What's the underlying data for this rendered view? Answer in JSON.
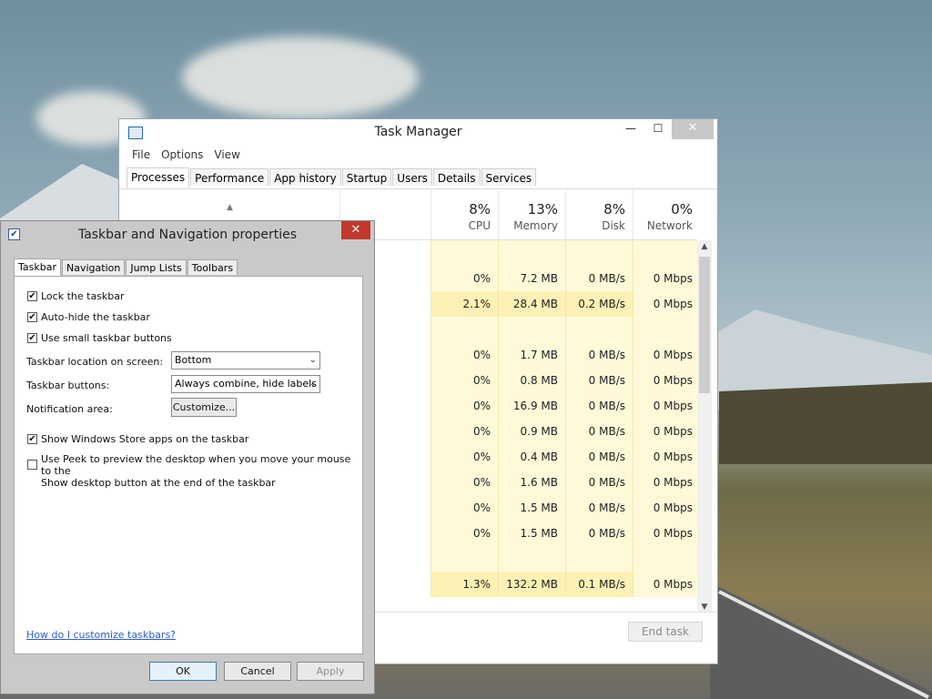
{
  "task_manager": {
    "title": "Task Manager",
    "menu": [
      "File",
      "Options",
      "View"
    ],
    "tabs": [
      "Processes",
      "Performance",
      "App history",
      "Startup",
      "Users",
      "Details",
      "Services"
    ],
    "active_tab": "Processes",
    "columns": [
      {
        "pct": "8%",
        "label": "CPU"
      },
      {
        "pct": "13%",
        "label": "Memory"
      },
      {
        "pct": "8%",
        "label": "Disk"
      },
      {
        "pct": "0%",
        "label": "Network"
      }
    ],
    "rows": [
      {
        "cpu": "",
        "mem": "",
        "disk": "",
        "net": ""
      },
      {
        "cpu": "0%",
        "mem": "7.2 MB",
        "disk": "0 MB/s",
        "net": "0 Mbps"
      },
      {
        "cpu": "2.1%",
        "mem": "28.4 MB",
        "disk": "0.2 MB/s",
        "net": "0 Mbps"
      },
      {
        "cpu": "",
        "mem": "",
        "disk": "",
        "net": ""
      },
      {
        "cpu": "0%",
        "mem": "1.7 MB",
        "disk": "0 MB/s",
        "net": "0 Mbps"
      },
      {
        "cpu": "0%",
        "mem": "0.8 MB",
        "disk": "0 MB/s",
        "net": "0 Mbps"
      },
      {
        "cpu": "0%",
        "mem": "16.9 MB",
        "disk": "0 MB/s",
        "net": "0 Mbps"
      },
      {
        "cpu": "0%",
        "mem": "0.9 MB",
        "disk": "0 MB/s",
        "net": "0 Mbps"
      },
      {
        "cpu": "0%",
        "mem": "0.4 MB",
        "disk": "0 MB/s",
        "net": "0 Mbps"
      },
      {
        "cpu": "0%",
        "mem": "1.6 MB",
        "disk": "0 MB/s",
        "net": "0 Mbps"
      },
      {
        "cpu": "0%",
        "mem": "1.5 MB",
        "disk": "0 MB/s",
        "net": "0 Mbps"
      },
      {
        "cpu": "0%",
        "mem": "1.5 MB",
        "disk": "0 MB/s",
        "net": "0 Mbps"
      },
      {
        "cpu": "",
        "mem": "",
        "disk": "",
        "net": ""
      },
      {
        "cpu": "1.3%",
        "mem": "132.2 MB",
        "disk": "0.1 MB/s",
        "net": "0 Mbps"
      }
    ],
    "end_task": "End task",
    "close_glyph": "✕",
    "min_glyph": "—",
    "max_glyph": "☐"
  },
  "dialog": {
    "title": "Taskbar and Navigation properties",
    "close_glyph": "✕",
    "tabs": [
      "Taskbar",
      "Navigation",
      "Jump Lists",
      "Toolbars"
    ],
    "active_tab": "Taskbar",
    "checkboxes": [
      {
        "label": "Lock the taskbar",
        "checked": true
      },
      {
        "label": "Auto-hide the taskbar",
        "checked": true
      },
      {
        "label": "Use small taskbar buttons",
        "checked": true
      }
    ],
    "location_label": "Taskbar location on screen:",
    "location_value": "Bottom",
    "buttons_label": "Taskbar buttons:",
    "buttons_value": "Always combine, hide labels",
    "notification_label": "Notification area:",
    "customize_button": "Customize...",
    "store_apps": {
      "label": "Show Windows Store apps on the taskbar",
      "checked": true
    },
    "peek": {
      "label_line1": "Use Peek to preview the desktop when you move your mouse to the",
      "label_line2": "Show desktop button at the end of the taskbar",
      "checked": false
    },
    "help_link": "How do I customize taskbars?",
    "ok": "OK",
    "cancel": "Cancel",
    "apply": "Apply",
    "check_glyph": "✔"
  }
}
